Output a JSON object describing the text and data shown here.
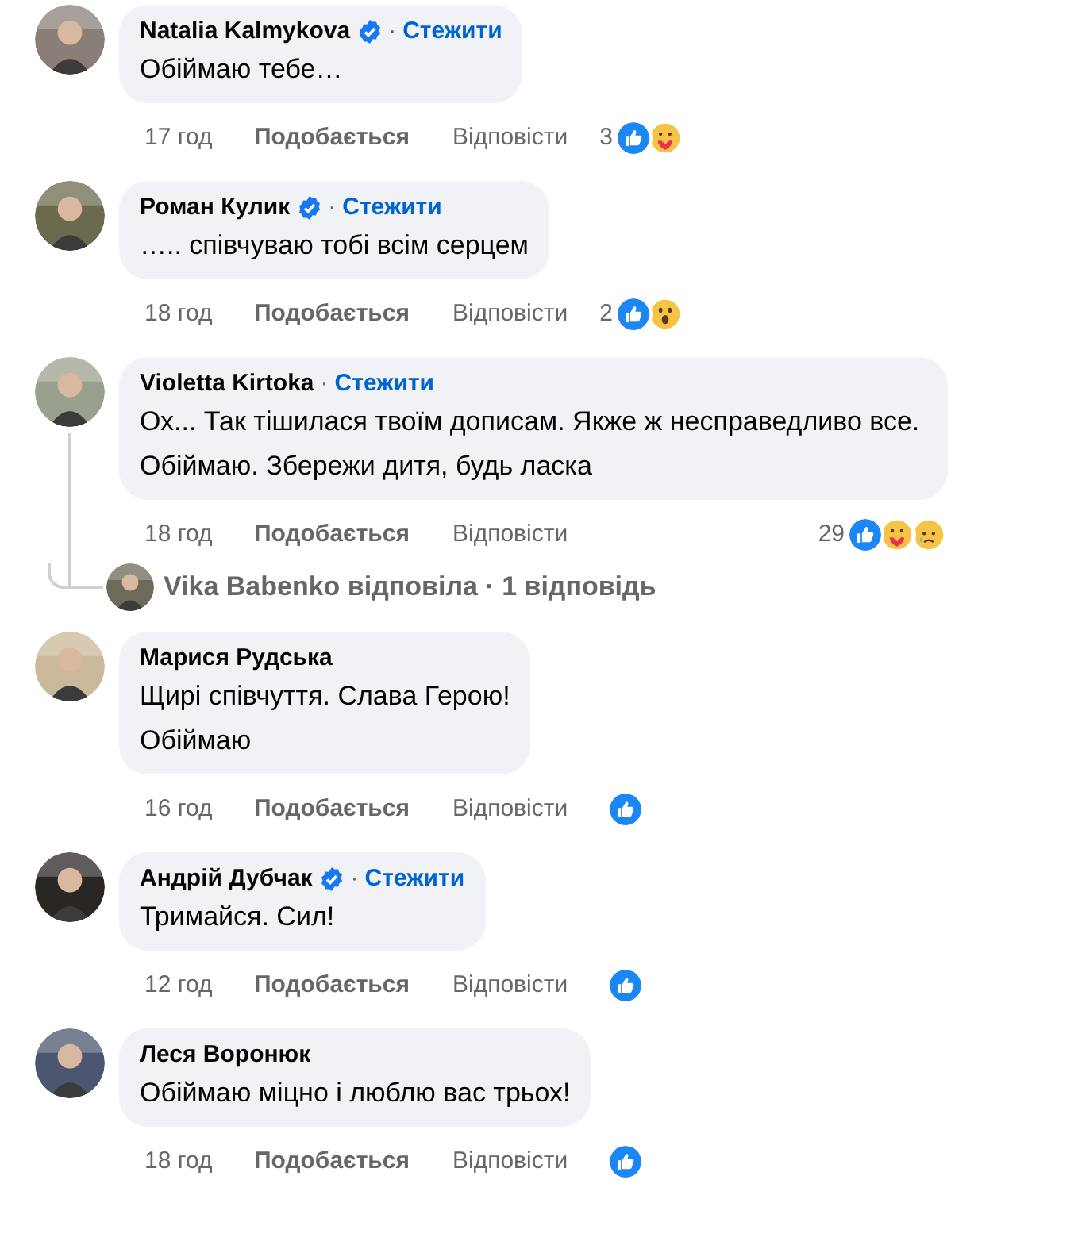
{
  "comments": [
    {
      "name": "Natalia Kalmykova",
      "verified": true,
      "separator": "·",
      "follow": "Стежити",
      "text": "Обіймаю тебе…",
      "time": "17 год",
      "like": "Подобається",
      "reply": "Відповісти",
      "reaction_count": "3",
      "reactions": [
        {
          "kind": "like"
        },
        {
          "kind": "care"
        }
      ]
    },
    {
      "name": "Роман Кулик",
      "verified": true,
      "separator": "·",
      "follow": "Стежити",
      "text": "….. співчуваю тобі всім серцем",
      "time": "18 год",
      "like": "Подобається",
      "reply": "Відповісти",
      "reaction_count": "2",
      "reactions": [
        {
          "kind": "like"
        },
        {
          "kind": "wow"
        }
      ]
    },
    {
      "name": "Violetta Kirtoka",
      "verified": false,
      "separator": "·",
      "follow": "Стежити",
      "text": "Ох... Так тішилася твоїм дописам. Якже ж несправедливо все. Обіймаю. Збережи дитя, будь ласка",
      "time": "18 год",
      "like": "Подобається",
      "reply": "Відповісти",
      "reaction_count": "29",
      "reactions": [
        {
          "kind": "like"
        },
        {
          "kind": "care"
        },
        {
          "kind": "sad"
        }
      ],
      "replies": {
        "author": "Vika Babenko",
        "text": " відповіла · 1 відповідь"
      }
    },
    {
      "name": "Марися Рудська",
      "verified": false,
      "text": "Щирі співчуття. Слава Герою!\nОбіймаю",
      "time": "16 год",
      "like": "Подобається",
      "reply": "Відповісти",
      "reactions": [
        {
          "kind": "like"
        }
      ]
    },
    {
      "name": "Андрій Дубчак",
      "verified": true,
      "separator": "·",
      "follow": "Стежити",
      "text": "Тримайся. Сил!",
      "time": "12 год",
      "like": "Подобається",
      "reply": "Відповісти",
      "reactions": [
        {
          "kind": "like"
        }
      ]
    },
    {
      "name": "Леся Воронюк",
      "verified": false,
      "text": "Обіймаю міцно і люблю вас трьох!",
      "time": "18 год",
      "like": "Подобається",
      "reply": "Відповісти",
      "reactions": [
        {
          "kind": "like"
        }
      ]
    }
  ]
}
